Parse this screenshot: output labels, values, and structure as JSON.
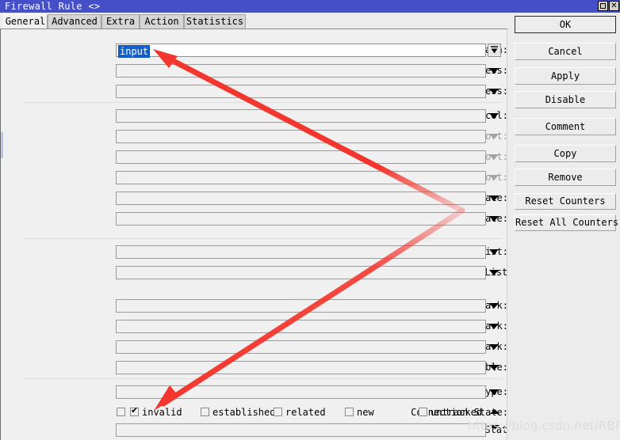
{
  "window": {
    "title": "Firewall Rule <>",
    "maximize_icon": "maximize-icon",
    "close_icon": "close-icon"
  },
  "tabs": [
    {
      "label": "General",
      "active": true
    },
    {
      "label": "Advanced",
      "active": false
    },
    {
      "label": "Extra",
      "active": false
    },
    {
      "label": "Action",
      "active": false
    },
    {
      "label": "Statistics",
      "active": false
    }
  ],
  "fields": [
    {
      "label": "Chain:",
      "value": "input",
      "disabled": false,
      "focused": true,
      "arrow": "double-down-arrow-icon"
    },
    {
      "label": "Src. Address:",
      "value": "",
      "disabled": false,
      "focused": false,
      "arrow": "chevron-down-icon"
    },
    {
      "label": "Dst. Address:",
      "value": "",
      "disabled": false,
      "focused": false,
      "arrow": "chevron-down-icon"
    },
    {
      "label": "Protocol:",
      "value": "",
      "disabled": false,
      "focused": false,
      "arrow": "chevron-down-icon"
    },
    {
      "label": "Src. Port:",
      "value": "",
      "disabled": true,
      "focused": false,
      "arrow": "chevron-down-icon"
    },
    {
      "label": "Dst. Port:",
      "value": "",
      "disabled": true,
      "focused": false,
      "arrow": "chevron-down-icon"
    },
    {
      "label": "Any. Port:",
      "value": "",
      "disabled": true,
      "focused": false,
      "arrow": "chevron-down-icon"
    },
    {
      "label": "In. Interface:",
      "value": "",
      "disabled": false,
      "focused": false,
      "arrow": "chevron-down-icon"
    },
    {
      "label": "Out. Interface:",
      "value": "",
      "disabled": false,
      "focused": false,
      "arrow": "chevron-down-icon"
    },
    {
      "label": "In. Interface List:",
      "value": "",
      "disabled": false,
      "focused": false,
      "arrow": "chevron-down-icon"
    },
    {
      "label": "Out. Interface List:",
      "value": "",
      "disabled": false,
      "focused": false,
      "arrow": "chevron-down-icon"
    },
    {
      "label": "Packet Mark:",
      "value": "",
      "disabled": false,
      "focused": false,
      "arrow": "chevron-down-icon"
    },
    {
      "label": "Connection Mark:",
      "value": "",
      "disabled": false,
      "focused": false,
      "arrow": "chevron-down-icon"
    },
    {
      "label": "Routing Mark:",
      "value": "",
      "disabled": false,
      "focused": false,
      "arrow": "chevron-down-icon"
    },
    {
      "label": "Routing Table:",
      "value": "",
      "disabled": false,
      "focused": false,
      "arrow": "chevron-down-icon"
    },
    {
      "label": "Connection Type:",
      "value": "",
      "disabled": false,
      "focused": false,
      "arrow": "chevron-down-icon"
    }
  ],
  "connection_state": {
    "label": "Connection State:",
    "enable_checkbox_checked": false,
    "options": [
      {
        "label": "invalid",
        "checked": true
      },
      {
        "label": "established",
        "checked": false
      },
      {
        "label": "related",
        "checked": false
      },
      {
        "label": "new",
        "checked": false
      },
      {
        "label": "untracked",
        "checked": false
      }
    ],
    "spinner_up_icon": "spinner-up-arrow-icon",
    "spinner_down_icon": "spinner-down-arrow-icon"
  },
  "connection_nat_state": {
    "label": "Connection NAT State:",
    "value": "",
    "arrow": "chevron-down-icon"
  },
  "buttons": [
    {
      "label": "OK",
      "default": true
    },
    {
      "label": "Cancel",
      "default": false
    },
    {
      "label": "Apply",
      "default": false
    },
    {
      "label": "Disable",
      "default": false
    },
    {
      "label": "Comment",
      "default": false
    },
    {
      "label": "Copy",
      "default": false
    },
    {
      "label": "Remove",
      "default": false
    },
    {
      "label": "Reset Counters",
      "default": false
    },
    {
      "label": "Reset All Counters",
      "default": false
    }
  ],
  "annotation": {
    "color": "#f4372e",
    "description": "red-polyline-arrow"
  },
  "watermark": {
    "text": "https://blog.csdn.net/RBPicsdn"
  },
  "colors": {
    "titlebar": "#4550c8",
    "panel": "#f0f0f0",
    "selection": "#1061d0",
    "annotation": "#f4372e"
  }
}
